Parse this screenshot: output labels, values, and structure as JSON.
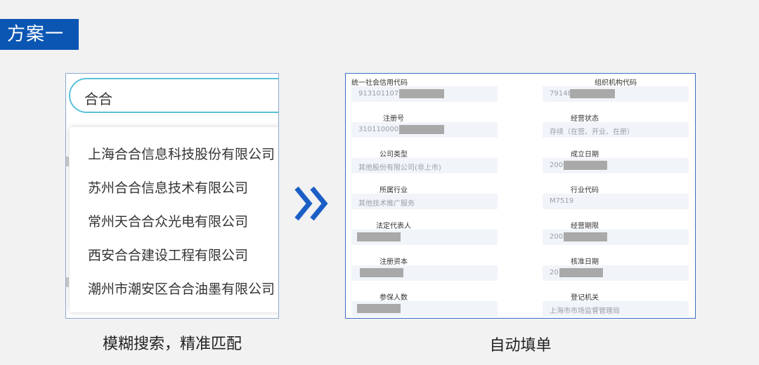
{
  "header": {
    "title": "方案一"
  },
  "search": {
    "query": "合合",
    "suggestions": [
      "上海合合信息科技股份有限公司",
      "苏州合合信息技术有限公司",
      "常州天合合众光电有限公司",
      "西安合合建设工程有限公司",
      "潮州市潮安区合合油墨有限公司"
    ],
    "caption": "模糊搜索，精准匹配"
  },
  "form": {
    "caption": "自动填单",
    "fields": [
      {
        "label": "统一社会信用代码",
        "value": "913101107"
      },
      {
        "label": "组织机构代码",
        "value": "79148"
      },
      {
        "label": "注册号",
        "value": "3101100003"
      },
      {
        "label": "经营状态",
        "value": "存续（在营、开业、在册）"
      },
      {
        "label": "公司类型",
        "value": "其他股份有限公司(非上市)"
      },
      {
        "label": "成立日期",
        "value": "200"
      },
      {
        "label": "所属行业",
        "value": "其他技术推广服务"
      },
      {
        "label": "行业代码",
        "value": "M7519"
      },
      {
        "label": "法定代表人",
        "value": ""
      },
      {
        "label": "经营期限",
        "value": "200"
      },
      {
        "label": "注册资本",
        "value": ""
      },
      {
        "label": "核准日期",
        "value": "20"
      },
      {
        "label": "参保人数",
        "value": ""
      },
      {
        "label": "登记机关",
        "value": "上海市市场监督管理局"
      }
    ]
  },
  "colors": {
    "accent": "#0b56b3",
    "search_border": "#59c1d9",
    "arrow": "#1b5fc6"
  },
  "icons": {
    "arrow": "double-chevron-right-icon"
  }
}
